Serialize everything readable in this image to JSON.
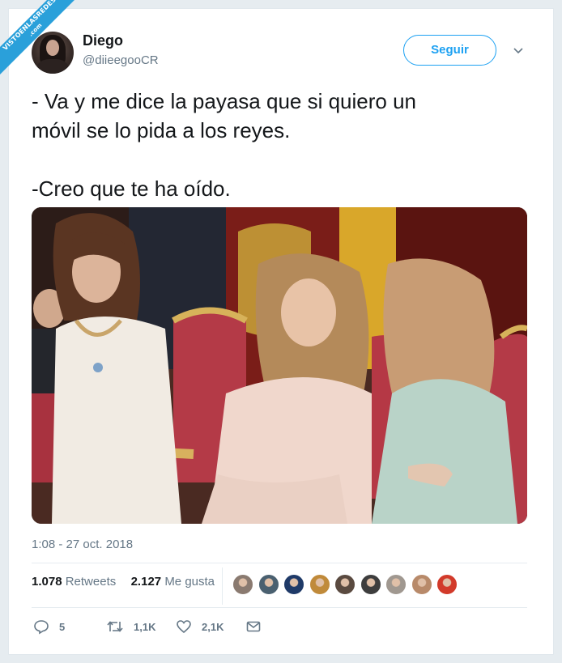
{
  "watermark": {
    "line1": "VISTOENLASREDES",
    "line2": ".com"
  },
  "author": {
    "name": "Diego",
    "handle": "@diieegooCR"
  },
  "follow_button": {
    "label": "Seguir"
  },
  "tweet": {
    "text": "- Va y me dice la payasa que si quiero un\nmóvil se lo pida a los reyes.\n\n-Creo que te ha oído."
  },
  "timestamp": "1:08 - 27 oct. 2018",
  "stats": {
    "retweets_count": "1.078",
    "retweets_label": "Retweets",
    "likes_count": "2.127",
    "likes_label": "Me gusta"
  },
  "likers": [
    {
      "icon": "liker-avatar",
      "color": "#8a7a70"
    },
    {
      "icon": "liker-avatar",
      "color": "#4a6070"
    },
    {
      "icon": "liker-avatar",
      "color": "#1f3a68"
    },
    {
      "icon": "liker-avatar",
      "color": "#c08a3a"
    },
    {
      "icon": "liker-avatar",
      "color": "#5a4a40"
    },
    {
      "icon": "liker-avatar",
      "color": "#3d3d3d"
    },
    {
      "icon": "liker-avatar",
      "color": "#a09890"
    },
    {
      "icon": "liker-avatar",
      "color": "#b88a6a"
    },
    {
      "icon": "liker-avatar",
      "color": "#d23a2a"
    }
  ],
  "actions": {
    "replies": "5",
    "retweets": "1,1K",
    "likes": "2,1K"
  },
  "colors": {
    "accent": "#1da1f2",
    "muted": "#657786",
    "text": "#14171a",
    "watermark": "#2aa0da"
  }
}
